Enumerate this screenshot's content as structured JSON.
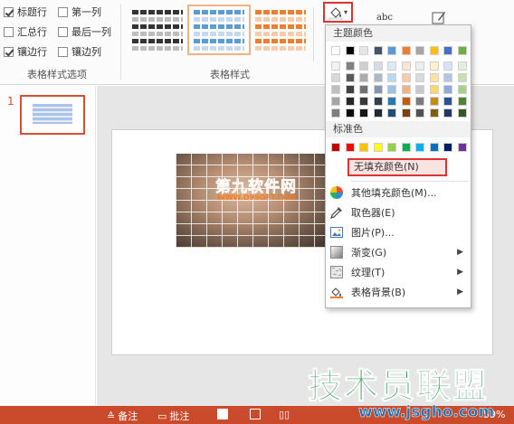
{
  "table_style_options": {
    "items": [
      {
        "label": "标题行",
        "checked": true
      },
      {
        "label": "第一列",
        "checked": false
      },
      {
        "label": "汇总行",
        "checked": false
      },
      {
        "label": "最后一列",
        "checked": false
      },
      {
        "label": "镶边行",
        "checked": true
      },
      {
        "label": "镶边列",
        "checked": false
      }
    ],
    "group_label": "表格样式选项"
  },
  "table_styles": {
    "group_label": "表格样式",
    "selected_index": 1
  },
  "ribbon_right": {
    "text_label": "abc"
  },
  "slide_panel": {
    "slide_number": "1"
  },
  "watermarks": {
    "d9soft_main": "第九软件网",
    "d9soft_sub": "WWW.D9SOFT.COM",
    "jsgho_main": "技术员联盟",
    "jsgho_site": "www.jsgho.com"
  },
  "statusbar": {
    "notes": "备注",
    "comments": "批注",
    "zoom": "59%"
  },
  "fill_menu": {
    "theme_colors_label": "主题颜色",
    "theme_colors": {
      "top_row": [
        "#ffffff",
        "#000000",
        "#e7e6e6",
        "#44546a",
        "#5b9bd5",
        "#ed7d31",
        "#a5a5a5",
        "#ffc000",
        "#4472c4",
        "#70ad47"
      ],
      "shades": [
        [
          "#f2f2f2",
          "#808080",
          "#d0cece",
          "#d6dce4",
          "#deebf6",
          "#fbe5d5",
          "#ededed",
          "#fff2cc",
          "#d9e2f3",
          "#e2efd9"
        ],
        [
          "#d8d8d8",
          "#595959",
          "#aeabab",
          "#adb9ca",
          "#bdd7ee",
          "#f7cbac",
          "#dbdbdb",
          "#fee599",
          "#b4c6e7",
          "#c5e0b3"
        ],
        [
          "#bfbfbf",
          "#3f3f3f",
          "#757070",
          "#8496b0",
          "#9cc3e5",
          "#f4b183",
          "#c9c9c9",
          "#ffd965",
          "#8eaadb",
          "#a8d08d"
        ],
        [
          "#a5a5a5",
          "#262626",
          "#3a3838",
          "#323f4f",
          "#2e75b5",
          "#c55a11",
          "#7b7b7b",
          "#bf9000",
          "#2f5496",
          "#538135"
        ],
        [
          "#7f7f7f",
          "#0c0c0c",
          "#171616",
          "#222a35",
          "#1e4e79",
          "#843c0b",
          "#525252",
          "#7f6000",
          "#1f3864",
          "#375623"
        ]
      ]
    },
    "standard_colors_label": "标准色",
    "standard_colors": [
      "#c00000",
      "#ff0000",
      "#ffc000",
      "#ffff00",
      "#92d050",
      "#00b050",
      "#00b0f0",
      "#0070c0",
      "#002060",
      "#7030a0"
    ],
    "no_fill": "无填充颜色(N)",
    "items": [
      {
        "label": "其他填充颜色(M)...",
        "icon": "color-wheel-icon",
        "submenu": false
      },
      {
        "label": "取色器(E)",
        "icon": "eyedropper-icon",
        "submenu": false
      },
      {
        "label": "图片(P)...",
        "icon": "picture-icon",
        "submenu": false
      },
      {
        "label": "渐变(G)",
        "icon": "gradient-icon",
        "submenu": true
      },
      {
        "label": "纹理(T)",
        "icon": "texture-icon",
        "submenu": true
      },
      {
        "label": "表格背景(B)",
        "icon": "table-background-icon",
        "submenu": true
      }
    ]
  }
}
